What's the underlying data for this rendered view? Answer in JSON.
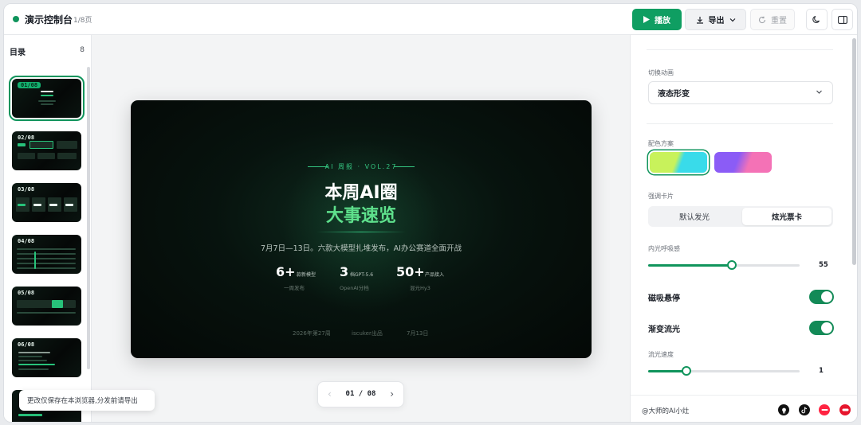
{
  "header": {
    "title": "演示控制台",
    "page_count": "1/8页",
    "play_label": "播放",
    "export_label": "导出",
    "reset_label": "重置"
  },
  "sidebar": {
    "title": "目录",
    "count": "8",
    "thumbs": [
      "01/08",
      "02/08",
      "03/08",
      "04/08",
      "05/08",
      "06/08"
    ]
  },
  "toast": "更改仅保存在本浏览器,分发前请导出",
  "slide": {
    "eyebrow": "AI 周报 · VOL.27",
    "title_line1": "本周AI圈",
    "title_line2": "大事速览",
    "subtitle": "7月7日—13日。六款大模型扎堆发布，AI办公赛道全面开战",
    "stats": [
      {
        "big": "6+",
        "small": "款新模型",
        "foot": "一周发布"
      },
      {
        "big": "3",
        "small": "档GPT-5.6",
        "foot": "OpenAI分档"
      },
      {
        "big": "50+",
        "small": "产品接入",
        "foot": "混元Hy3"
      }
    ],
    "footer": [
      "2026年第27周",
      "iscuker出品",
      "7月13日"
    ]
  },
  "pager": {
    "text": "01 / 08"
  },
  "panel": {
    "transition_label": "切换动画",
    "transition_value": "液态形变",
    "palette_label": "配色方案",
    "card_label": "强调卡片",
    "card_options": [
      "默认发光",
      "炫光票卡"
    ],
    "breath_label": "内光呼吸感",
    "breath_value": "55",
    "breath_level": 0.55,
    "magnet_label": "磁吸悬停",
    "gradient_label": "渐变流光",
    "speed_label": "流光速度",
    "speed_value": "1",
    "speed_level": 0.25,
    "author": "@大师的AI小灶",
    "palette_colors": [
      "#c8f25b",
      "#39dbea",
      "#8b5cf6",
      "#f472b6"
    ],
    "accent": "#10945c"
  }
}
